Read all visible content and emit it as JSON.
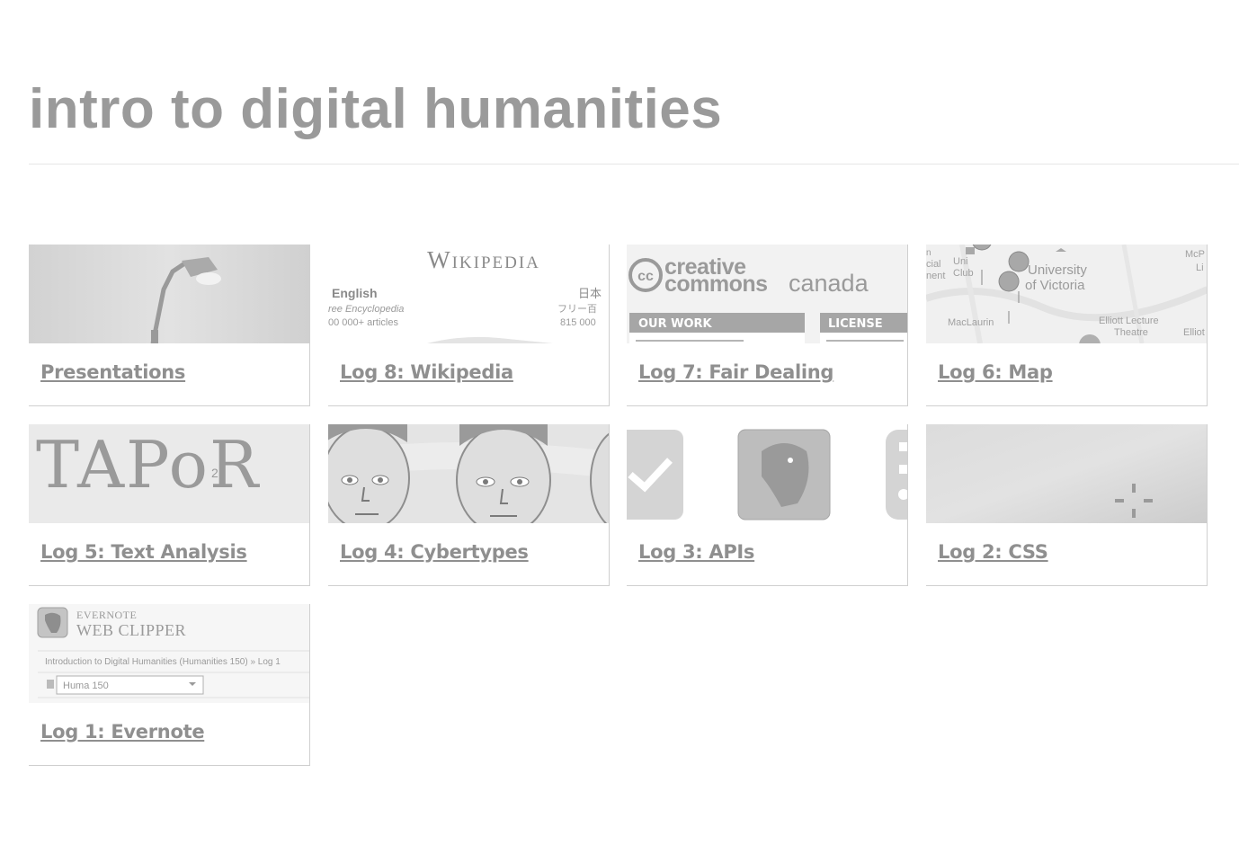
{
  "site": {
    "title": "intro to digital humanities"
  },
  "posts": [
    {
      "title": "Presentations",
      "thumb_icon": "streetlamp-photo"
    },
    {
      "title": "Log 8: Wikipedia",
      "thumb_icon": "wikipedia-portal-screenshot",
      "thumb_text": {
        "logo": "Wikipedia",
        "lang": "English",
        "sub": "ree Encyclopedia",
        "count": "00 000+ articles",
        "jp": "日本",
        "jp_sub": "フリー百",
        "jp_count": "815 000"
      }
    },
    {
      "title": "Log 7: Fair Dealing",
      "thumb_icon": "creative-commons-canada-screenshot",
      "thumb_text": {
        "cc": "cc",
        "line1": "creative",
        "line2": "commons",
        "line2b": "canada",
        "tab1": "OUR WORK",
        "tab2": "LICENSE"
      }
    },
    {
      "title": "Log 6: Map",
      "thumb_icon": "map-screenshot",
      "thumb_text": {
        "place1": "University",
        "place2": "of Victoria",
        "place3": "MacLaurin",
        "place4": "Elliott Lecture",
        "place5": "Theatre",
        "frag1": "Uni",
        "frag2": "Club",
        "frag3": "cial",
        "frag4": "nent",
        "frag5": "McP",
        "frag6": "Li",
        "frag7": "Elliot"
      }
    },
    {
      "title": "Log 5: Text Analysis",
      "thumb_icon": "tapor-logo",
      "thumb_text": {
        "logo": "TAPoR",
        "badge": "2"
      }
    },
    {
      "title": "Log 4: Cybertypes",
      "thumb_icon": "cartoon-faces"
    },
    {
      "title": "Log 3: APIs",
      "thumb_icon": "app-icons"
    },
    {
      "title": "Log 2: CSS",
      "thumb_icon": "gradient-screenshot"
    },
    {
      "title": "Log 1: Evernote",
      "thumb_icon": "evernote-web-clipper-screenshot",
      "thumb_text": {
        "brand": "EVERNOTE",
        "product": "WEB CLIPPER",
        "crumb": "Introduction to Digital Humanities (Humanities 150) » Log 1",
        "notebook": "Huma 150"
      }
    }
  ]
}
